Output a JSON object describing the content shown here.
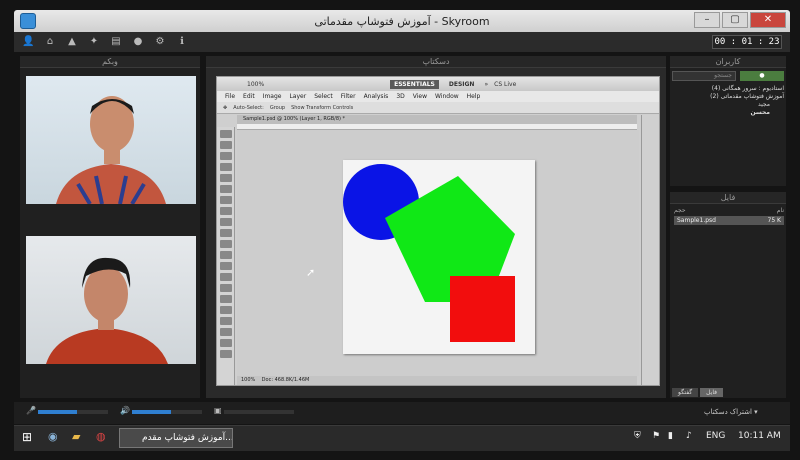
{
  "window": {
    "title": "آموزش فتوشاپ مقدماتی - Skyroom"
  },
  "timer": "00 : 01 : 23",
  "panels": {
    "webcam_title": "وبکم",
    "desktop_title": "دسکتاپ",
    "users_title": "کاربران",
    "files_title": "فایل"
  },
  "users": {
    "search_placeholder": "جستجو",
    "tree": [
      "استادیوم : سرور همگانی (4)",
      "آموزش فتوشاپ مقدماتی (2)",
      "مجید",
      "محسن"
    ]
  },
  "files": {
    "header_name": "نام",
    "header_size": "حجم",
    "rows": [
      {
        "name": "Sample1.psd",
        "size": "75 K"
      }
    ],
    "tabs": [
      "فایل",
      "گفتگو"
    ]
  },
  "photoshop": {
    "workspaces": [
      "ESSENTIALS",
      "DESIGN"
    ],
    "active_workspace": "ESSENTIALS",
    "cs_live": "CS Live",
    "zoom": "100%",
    "menus": [
      "File",
      "Edit",
      "Image",
      "Layer",
      "Select",
      "Filter",
      "Analysis",
      "3D",
      "View",
      "Window",
      "Help"
    ],
    "options": [
      "Auto-Select:",
      "Group",
      "Show Transform Controls"
    ],
    "doc_tab": "Sample1.psd @ 100% (Layer 1, RGB/8) *",
    "status_zoom": "100%",
    "status_doc": "Doc: 468.8K/1.46M"
  },
  "bottom": {
    "share_label": "اشتراک دسکتاپ",
    "mic_level": 0.55,
    "speaker_level": 0.55
  },
  "taskbar": {
    "app_label": "آموزش فتوشاپ مقدم...",
    "lang": "ENG",
    "time": "10:11 AM"
  },
  "colors": {
    "circle": "#0a14e6",
    "pentagon": "#10e816",
    "square": "#f20d0d",
    "accent": "#2f7fd1"
  }
}
